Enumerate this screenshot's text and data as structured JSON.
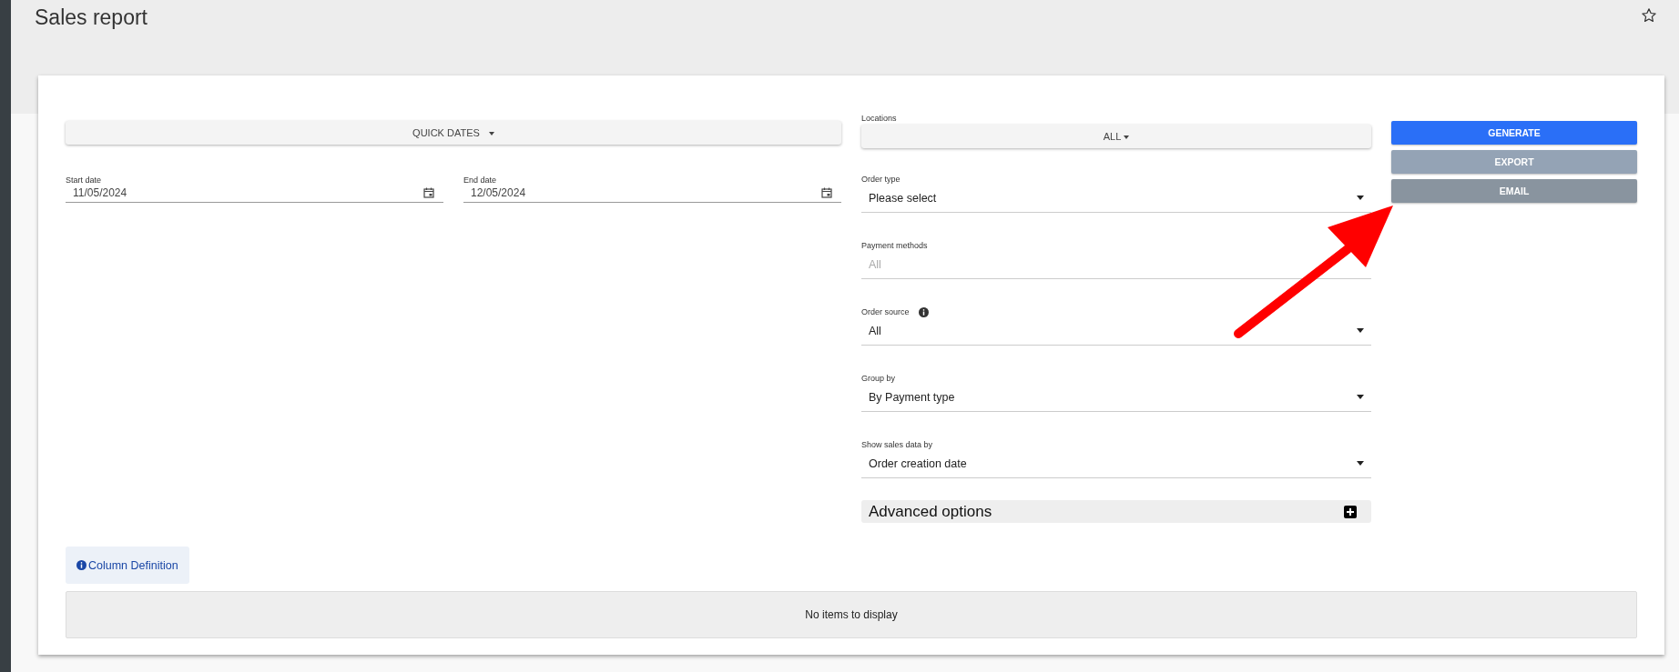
{
  "page": {
    "title": "Sales report"
  },
  "quick_dates": {
    "label": "QUICK DATES"
  },
  "dates": [
    {
      "label": "Start date",
      "value": "11/05/2024"
    },
    {
      "label": "End date",
      "value": "12/05/2024"
    }
  ],
  "locations": {
    "label": "Locations",
    "value": "ALL"
  },
  "filters": [
    {
      "kind": "select",
      "label": "Order type",
      "value": "Please select",
      "info": false
    },
    {
      "kind": "multiselect",
      "label": "Payment methods",
      "placeholder": "All",
      "info": false
    },
    {
      "kind": "select",
      "label": "Order source",
      "value": "All",
      "info": true
    },
    {
      "kind": "select",
      "label": "Group by",
      "value": "By Payment type",
      "info": false
    },
    {
      "kind": "select",
      "label": "Show sales data by",
      "value": "Order creation date",
      "info": false
    }
  ],
  "advanced_options": {
    "label": "Advanced options",
    "expanded": false
  },
  "actions": [
    {
      "kind": "primary",
      "label": "GENERATE"
    },
    {
      "kind": "light",
      "label": "EXPORT"
    },
    {
      "kind": "dark",
      "label": "EMAIL"
    }
  ],
  "column_definition": {
    "label": "Column Definition"
  },
  "table": {
    "empty_message": "No items to display"
  }
}
